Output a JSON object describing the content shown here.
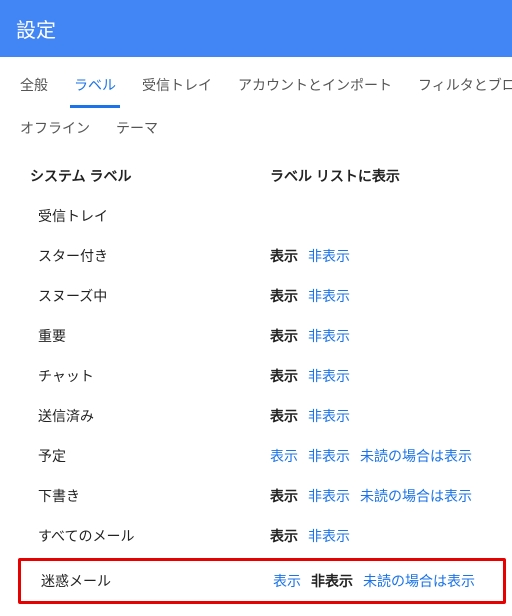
{
  "header": {
    "title": "設定"
  },
  "tabs_row1": [
    {
      "label": "全般",
      "active": false
    },
    {
      "label": "ラベル",
      "active": true
    },
    {
      "label": "受信トレイ",
      "active": false
    },
    {
      "label": "アカウントとインポート",
      "active": false
    },
    {
      "label": "フィルタとブロック",
      "active": false
    }
  ],
  "tabs_row2": [
    {
      "label": "オフライン",
      "active": false
    },
    {
      "label": "テーマ",
      "active": false
    }
  ],
  "columns": {
    "left": "システム ラベル",
    "right": "ラベル リストに表示"
  },
  "rows": [
    {
      "label": "受信トレイ",
      "show": null,
      "hide": null,
      "unread": null,
      "show_bold": false,
      "hide_bold": false,
      "highlight": false
    },
    {
      "label": "スター付き",
      "show": "表示",
      "hide": "非表示",
      "unread": null,
      "show_bold": true,
      "hide_bold": false,
      "highlight": false
    },
    {
      "label": "スヌーズ中",
      "show": "表示",
      "hide": "非表示",
      "unread": null,
      "show_bold": true,
      "hide_bold": false,
      "highlight": false
    },
    {
      "label": "重要",
      "show": "表示",
      "hide": "非表示",
      "unread": null,
      "show_bold": true,
      "hide_bold": false,
      "highlight": false
    },
    {
      "label": "チャット",
      "show": "表示",
      "hide": "非表示",
      "unread": null,
      "show_bold": true,
      "hide_bold": false,
      "highlight": false
    },
    {
      "label": "送信済み",
      "show": "表示",
      "hide": "非表示",
      "unread": null,
      "show_bold": true,
      "hide_bold": false,
      "highlight": false
    },
    {
      "label": "予定",
      "show": "表示",
      "hide": "非表示",
      "unread": "未読の場合は表示",
      "show_bold": false,
      "hide_bold": false,
      "highlight": false
    },
    {
      "label": "下書き",
      "show": "表示",
      "hide": "非表示",
      "unread": "未読の場合は表示",
      "show_bold": true,
      "hide_bold": false,
      "highlight": false
    },
    {
      "label": "すべてのメール",
      "show": "表示",
      "hide": "非表示",
      "unread": null,
      "show_bold": true,
      "hide_bold": false,
      "highlight": false
    },
    {
      "label": "迷惑メール",
      "show": "表示",
      "hide": "非表示",
      "unread": "未読の場合は表示",
      "show_bold": false,
      "hide_bold": true,
      "highlight": true
    }
  ]
}
